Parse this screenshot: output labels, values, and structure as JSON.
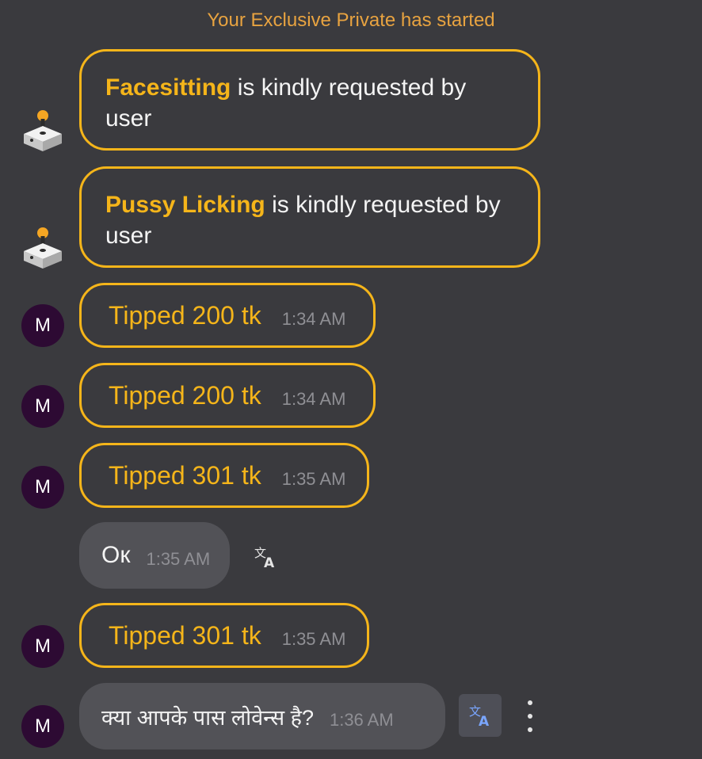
{
  "system_message": "Your Exclusive Private has started",
  "requests": [
    {
      "highlight": "Facesitting",
      "text": " is kindly requested by user"
    },
    {
      "highlight": "Pussy Licking",
      "text": " is kindly requested by user"
    }
  ],
  "tips": [
    {
      "avatar": "M",
      "text": "Tipped 200 tk",
      "time": "1:34 AM"
    },
    {
      "avatar": "M",
      "text": "Tipped 200 tk",
      "time": "1:34 AM"
    },
    {
      "avatar": "M",
      "text": "Tipped 301 tk",
      "time": "1:35 AM"
    },
    {
      "avatar": "M",
      "text": "Tipped 301 tk",
      "time": "1:35 AM"
    }
  ],
  "messages": [
    {
      "text": "Ок",
      "time": "1:35 AM",
      "icon": "translate-icon"
    },
    {
      "avatar": "M",
      "text": "क्या आपके पास लोवेन्स है?",
      "time": "1:36 AM",
      "icon": "translate-icon"
    }
  ],
  "colors": {
    "accent": "#f5b51a",
    "avatar_bg": "#2d0a33",
    "background": "#3a3a3e",
    "translate_active": "#7aa6ff"
  }
}
